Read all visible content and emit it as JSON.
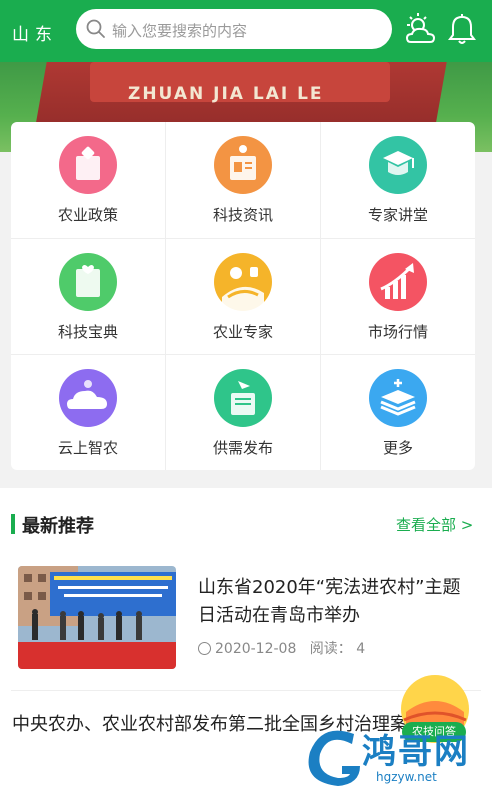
{
  "header": {
    "region": "山东",
    "search_placeholder": "输入您要搜索的内容",
    "colors": {
      "primary": "#1aad4f"
    }
  },
  "banner": {
    "text": "ZHUAN JIA LAI LE"
  },
  "grid": [
    {
      "label": "农业政策",
      "icon": "policy-book-icon",
      "color": "#f3698a"
    },
    {
      "label": "科技资讯",
      "icon": "tech-news-icon",
      "color": "#f39443"
    },
    {
      "label": "专家讲堂",
      "icon": "expert-lecture-icon",
      "color": "#33c4a4"
    },
    {
      "label": "科技宝典",
      "icon": "tech-handbook-icon",
      "color": "#4fcb6a"
    },
    {
      "label": "农业专家",
      "icon": "agri-expert-icon",
      "color": "#f5b42a"
    },
    {
      "label": "市场行情",
      "icon": "market-trend-icon",
      "color": "#f45463"
    },
    {
      "label": "云上智农",
      "icon": "cloud-agri-icon",
      "color": "#8d6cf0"
    },
    {
      "label": "供需发布",
      "icon": "supply-demand-icon",
      "color": "#2fc58a"
    },
    {
      "label": "更多",
      "icon": "more-layers-icon",
      "color": "#3ba8f0"
    }
  ],
  "recommend": {
    "title": "最新推荐",
    "view_all": "查看全部 >",
    "items": [
      {
        "title": "山东省2020年“宪法进农村”主题日活动在青岛市举办",
        "date": "2020-12-08",
        "reads_label": "阅读：",
        "reads": "4"
      },
      {
        "title": "中央农办、农业农村部发布第二批全国乡村治理案例"
      }
    ]
  },
  "float_button": {
    "label": "农技问答"
  },
  "watermark": {
    "brand": "鸿哥网",
    "url": "hgzyw.net"
  }
}
